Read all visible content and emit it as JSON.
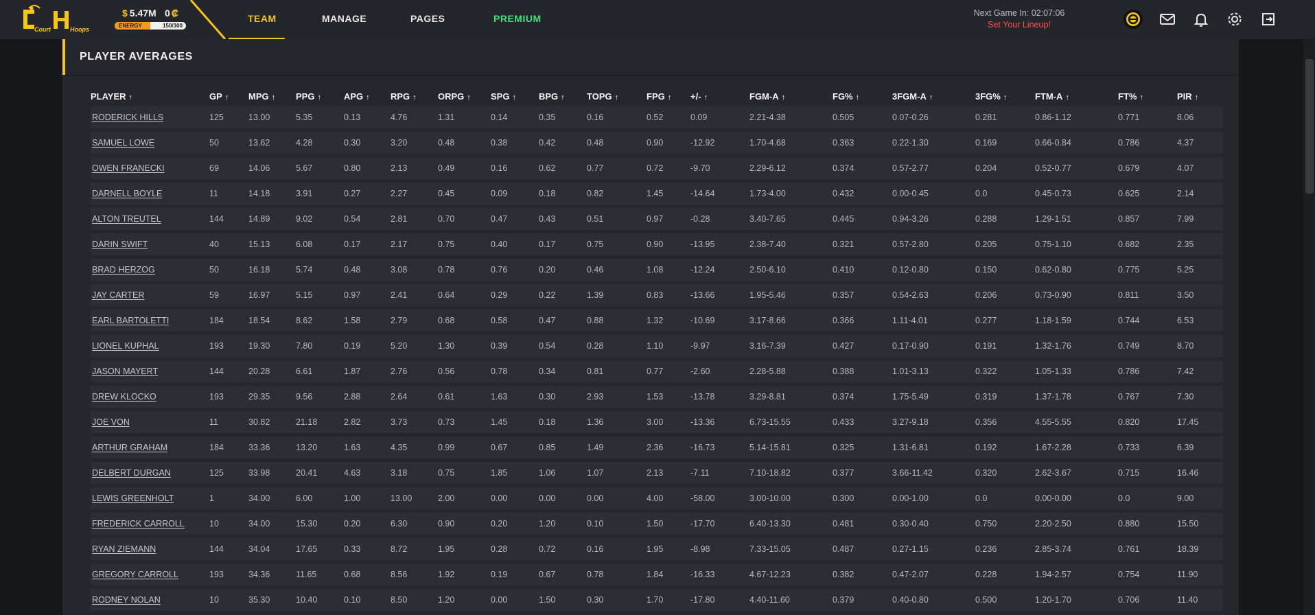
{
  "header": {
    "logo_text": "CourtHoops",
    "cash": "5.47M",
    "coins": "0",
    "energy": {
      "label": "ENERGY",
      "value": "150/300",
      "fraction": 0.5
    },
    "nav": [
      {
        "label": "TEAM",
        "dropdown": true,
        "active": true
      },
      {
        "label": "MANAGE",
        "dropdown": true,
        "active": false
      },
      {
        "label": "PAGES",
        "dropdown": true,
        "active": false
      },
      {
        "label": "PREMIUM",
        "dropdown": false,
        "active": false
      }
    ],
    "next_game": "Next Game In: 02:07:06",
    "set_lineup": "Set Your Lineup!",
    "icons": [
      "coin-avatar-icon",
      "mail-icon",
      "bell-icon",
      "gear-icon",
      "logout-icon"
    ]
  },
  "panel": {
    "title": "PLAYER AVERAGES"
  },
  "table": {
    "columns": [
      "PLAYER",
      "GP",
      "MPG",
      "PPG",
      "APG",
      "RPG",
      "ORPG",
      "SPG",
      "BPG",
      "TOPG",
      "FPG",
      "+/-",
      "FGM-A",
      "FG%",
      "3FGM-A",
      "3FG%",
      "FTM-A",
      "FT%",
      "PIR"
    ],
    "sort_arrow": "↑",
    "rows": [
      [
        "RODERICK HILLS",
        "125",
        "13.00",
        "5.35",
        "0.13",
        "4.76",
        "1.31",
        "0.14",
        "0.35",
        "0.16",
        "0.52",
        "0.09",
        "2.21-4.38",
        "0.505",
        "0.07-0.26",
        "0.281",
        "0.86-1.12",
        "0.771",
        "8.06"
      ],
      [
        "SAMUEL LOWE",
        "50",
        "13.62",
        "4.28",
        "0.30",
        "3.20",
        "0.48",
        "0.38",
        "0.42",
        "0.48",
        "0.90",
        "-12.92",
        "1.70-4.68",
        "0.363",
        "0.22-1.30",
        "0.169",
        "0.66-0.84",
        "0.786",
        "4.37"
      ],
      [
        "OWEN FRANECKI",
        "69",
        "14.06",
        "5.67",
        "0.80",
        "2.13",
        "0.49",
        "0.16",
        "0.62",
        "0.77",
        "0.72",
        "-9.70",
        "2.29-6.12",
        "0.374",
        "0.57-2.77",
        "0.204",
        "0.52-0.77",
        "0.679",
        "4.07"
      ],
      [
        "DARNELL BOYLE",
        "11",
        "14.18",
        "3.91",
        "0.27",
        "2.27",
        "0.45",
        "0.09",
        "0.18",
        "0.82",
        "1.45",
        "-14.64",
        "1.73-4.00",
        "0.432",
        "0.00-0.45",
        "0.0",
        "0.45-0.73",
        "0.625",
        "2.14"
      ],
      [
        "ALTON TREUTEL",
        "144",
        "14.89",
        "9.02",
        "0.54",
        "2.81",
        "0.70",
        "0.47",
        "0.43",
        "0.51",
        "0.97",
        "-0.28",
        "3.40-7.65",
        "0.445",
        "0.94-3.26",
        "0.288",
        "1.29-1.51",
        "0.857",
        "7.99"
      ],
      [
        "DARIN SWIFT",
        "40",
        "15.13",
        "6.08",
        "0.17",
        "2.17",
        "0.75",
        "0.40",
        "0.17",
        "0.75",
        "0.90",
        "-13.95",
        "2.38-7.40",
        "0.321",
        "0.57-2.80",
        "0.205",
        "0.75-1.10",
        "0.682",
        "2.35"
      ],
      [
        "BRAD HERZOG",
        "50",
        "16.18",
        "5.74",
        "0.48",
        "3.08",
        "0.78",
        "0.76",
        "0.20",
        "0.46",
        "1.08",
        "-12.24",
        "2.50-6.10",
        "0.410",
        "0.12-0.80",
        "0.150",
        "0.62-0.80",
        "0.775",
        "5.25"
      ],
      [
        "JAY CARTER",
        "59",
        "16.97",
        "5.15",
        "0.97",
        "2.41",
        "0.64",
        "0.29",
        "0.22",
        "1.39",
        "0.83",
        "-13.66",
        "1.95-5.46",
        "0.357",
        "0.54-2.63",
        "0.206",
        "0.73-0.90",
        "0.811",
        "3.50"
      ],
      [
        "EARL BARTOLETTI",
        "184",
        "18.54",
        "8.62",
        "1.58",
        "2.79",
        "0.68",
        "0.58",
        "0.47",
        "0.88",
        "1.32",
        "-10.69",
        "3.17-8.66",
        "0.366",
        "1.11-4.01",
        "0.277",
        "1.18-1.59",
        "0.744",
        "6.53"
      ],
      [
        "LIONEL KUPHAL",
        "193",
        "19.30",
        "7.80",
        "0.19",
        "5.20",
        "1.30",
        "0.39",
        "0.54",
        "0.28",
        "1.10",
        "-9.97",
        "3.16-7.39",
        "0.427",
        "0.17-0.90",
        "0.191",
        "1.32-1.76",
        "0.749",
        "8.70"
      ],
      [
        "JASON MAYERT",
        "144",
        "20.28",
        "6.61",
        "1.87",
        "2.76",
        "0.56",
        "0.78",
        "0.34",
        "0.81",
        "0.77",
        "-2.60",
        "2.28-5.88",
        "0.388",
        "1.01-3.13",
        "0.322",
        "1.05-1.33",
        "0.786",
        "7.42"
      ],
      [
        "DREW KLOCKO",
        "193",
        "29.35",
        "9.56",
        "2.88",
        "2.64",
        "0.61",
        "1.63",
        "0.30",
        "2.93",
        "1.53",
        "-13.78",
        "3.29-8.81",
        "0.374",
        "1.75-5.49",
        "0.319",
        "1.37-1.78",
        "0.767",
        "7.30"
      ],
      [
        "JOE VON",
        "11",
        "30.82",
        "21.18",
        "2.82",
        "3.73",
        "0.73",
        "1.45",
        "0.18",
        "1.36",
        "3.00",
        "-13.36",
        "6.73-15.55",
        "0.433",
        "3.27-9.18",
        "0.356",
        "4.55-5.55",
        "0.820",
        "17.45"
      ],
      [
        "ARTHUR GRAHAM",
        "184",
        "33.36",
        "13.20",
        "1.63",
        "4.35",
        "0.99",
        "0.67",
        "0.85",
        "1.49",
        "2.36",
        "-16.73",
        "5.14-15.81",
        "0.325",
        "1.31-6.81",
        "0.192",
        "1.67-2.28",
        "0.733",
        "6.39"
      ],
      [
        "DELBERT DURGAN",
        "125",
        "33.98",
        "20.41",
        "4.63",
        "3.18",
        "0.75",
        "1.85",
        "1.06",
        "1.07",
        "2.13",
        "-7.11",
        "7.10-18.82",
        "0.377",
        "3.66-11.42",
        "0.320",
        "2.62-3.67",
        "0.715",
        "16.46"
      ],
      [
        "LEWIS GREENHOLT",
        "1",
        "34.00",
        "6.00",
        "1.00",
        "13.00",
        "2.00",
        "0.00",
        "0.00",
        "0.00",
        "4.00",
        "-58.00",
        "3.00-10.00",
        "0.300",
        "0.00-1.00",
        "0.0",
        "0.00-0.00",
        "0.0",
        "9.00"
      ],
      [
        "FREDERICK CARROLL",
        "10",
        "34.00",
        "15.30",
        "0.20",
        "6.30",
        "0.90",
        "0.20",
        "1.20",
        "0.10",
        "1.50",
        "-17.70",
        "6.40-13.30",
        "0.481",
        "0.30-0.40",
        "0.750",
        "2.20-2.50",
        "0.880",
        "15.50"
      ],
      [
        "RYAN ZIEMANN",
        "144",
        "34.04",
        "17.65",
        "0.33",
        "8.72",
        "1.95",
        "0.28",
        "0.72",
        "0.16",
        "1.95",
        "-8.98",
        "7.33-15.05",
        "0.487",
        "0.27-1.15",
        "0.236",
        "2.85-3.74",
        "0.761",
        "18.39"
      ],
      [
        "GREGORY CARROLL",
        "193",
        "34.36",
        "11.65",
        "0.68",
        "8.56",
        "1.92",
        "0.19",
        "0.67",
        "0.78",
        "1.84",
        "-16.33",
        "4.67-12.23",
        "0.382",
        "0.47-2.07",
        "0.228",
        "1.94-2.57",
        "0.754",
        "11.90"
      ],
      [
        "RODNEY NOLAN",
        "10",
        "35.30",
        "10.40",
        "0.10",
        "8.50",
        "1.20",
        "0.00",
        "1.50",
        "0.30",
        "1.70",
        "-17.80",
        "4.40-11.60",
        "0.379",
        "0.40-0.80",
        "0.500",
        "1.20-1.70",
        "0.706",
        "11.40"
      ]
    ]
  }
}
